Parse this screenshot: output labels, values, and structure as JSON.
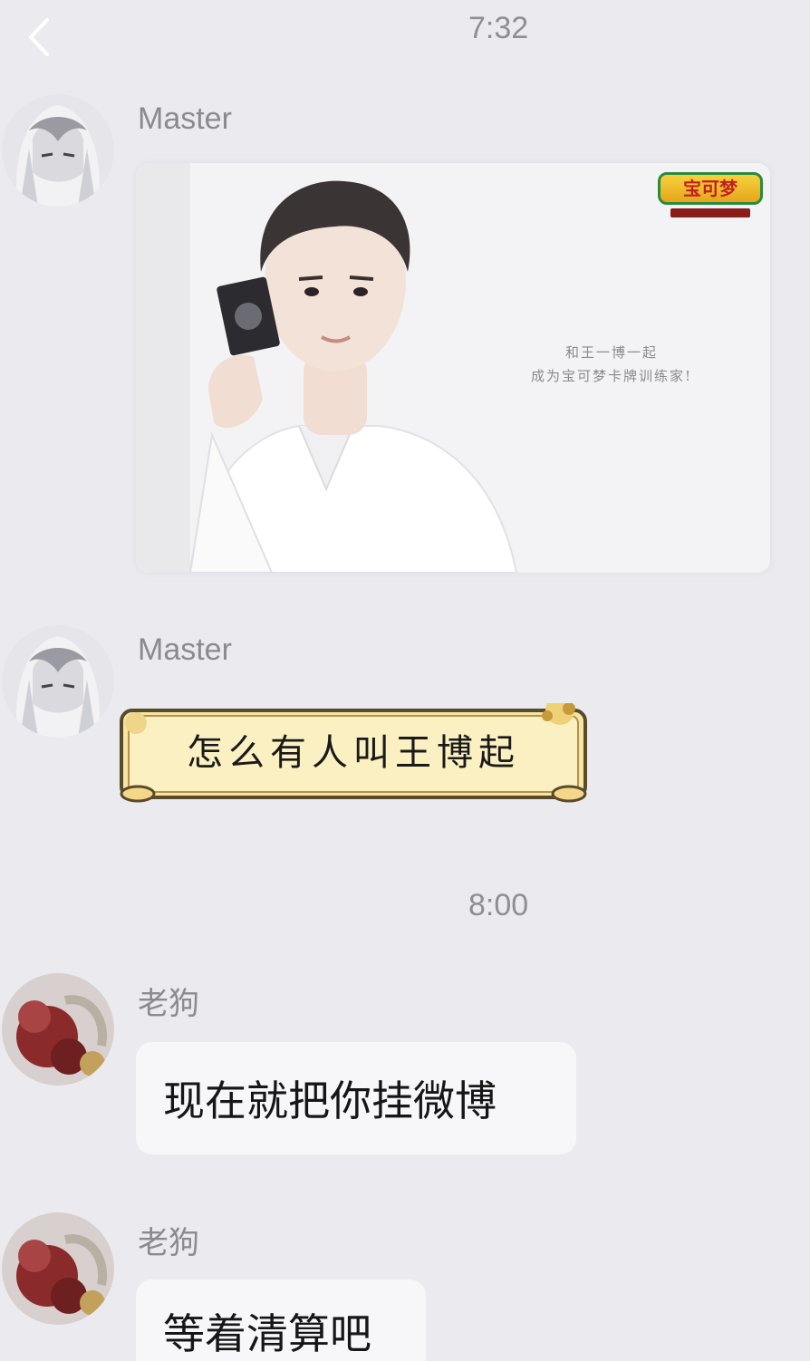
{
  "header": {
    "back_icon": "chevron-left-icon"
  },
  "messages": [
    {
      "type": "timestamp",
      "text": "7:32"
    },
    {
      "type": "image",
      "sender": "Master",
      "poster": {
        "brand": "宝可梦",
        "line1": "和王一博一起",
        "line2": "成为宝可梦卡牌训练家!"
      }
    },
    {
      "type": "sticker",
      "sender": "Master",
      "text": "怎么有人叫王博起"
    },
    {
      "type": "timestamp",
      "text": "8:00"
    },
    {
      "type": "text",
      "sender": "老狗",
      "text": "现在就把你挂微博"
    },
    {
      "type": "text",
      "sender": "老狗",
      "text": "等着清算吧"
    }
  ],
  "colors": {
    "background": "#ebebef",
    "bubble": "#f7f7f9",
    "meta_text": "#8e8e93"
  }
}
